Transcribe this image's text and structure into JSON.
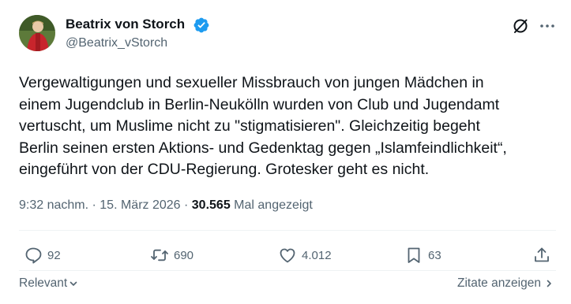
{
  "author": {
    "name": "Beatrix von Storch",
    "handle": "@Beatrix_vStorch",
    "avatar_icon": "avatar-photo",
    "verified_color": "#1d9bf0"
  },
  "post": {
    "text": "Vergewaltigungen und sexueller Missbrauch von jungen Mädchen in\neinem Jugendclub in Berlin-Neukölln wurden von Club und Jugendamt\nvertuscht, um Muslime nicht zu \"stigmatisieren\". Gleichzeitig begeht\nBerlin seinen ersten Aktions- und Gedenktag gegen „Islamfeindlichkeit“,\neingeführt von der CDU-Regierung. Grotesker geht es nicht.",
    "time": "9:32 nachm.",
    "sep1": " · ",
    "date": "15. März 2026",
    "sep2": " · ",
    "views": "30.565",
    "views_label": "Mal angezeigt"
  },
  "actions": {
    "replies": "92",
    "reposts": "690",
    "likes": "4.012",
    "bookmarks": "63"
  },
  "footer": {
    "sort_label": "Relevant",
    "quotes_label": "Zitate anzeigen"
  },
  "icons": [
    "grok-icon",
    "more-icon",
    "reply-icon",
    "repost-icon",
    "like-icon",
    "bookmark-icon",
    "share-icon",
    "chevron-down-icon",
    "chevron-right-icon"
  ]
}
